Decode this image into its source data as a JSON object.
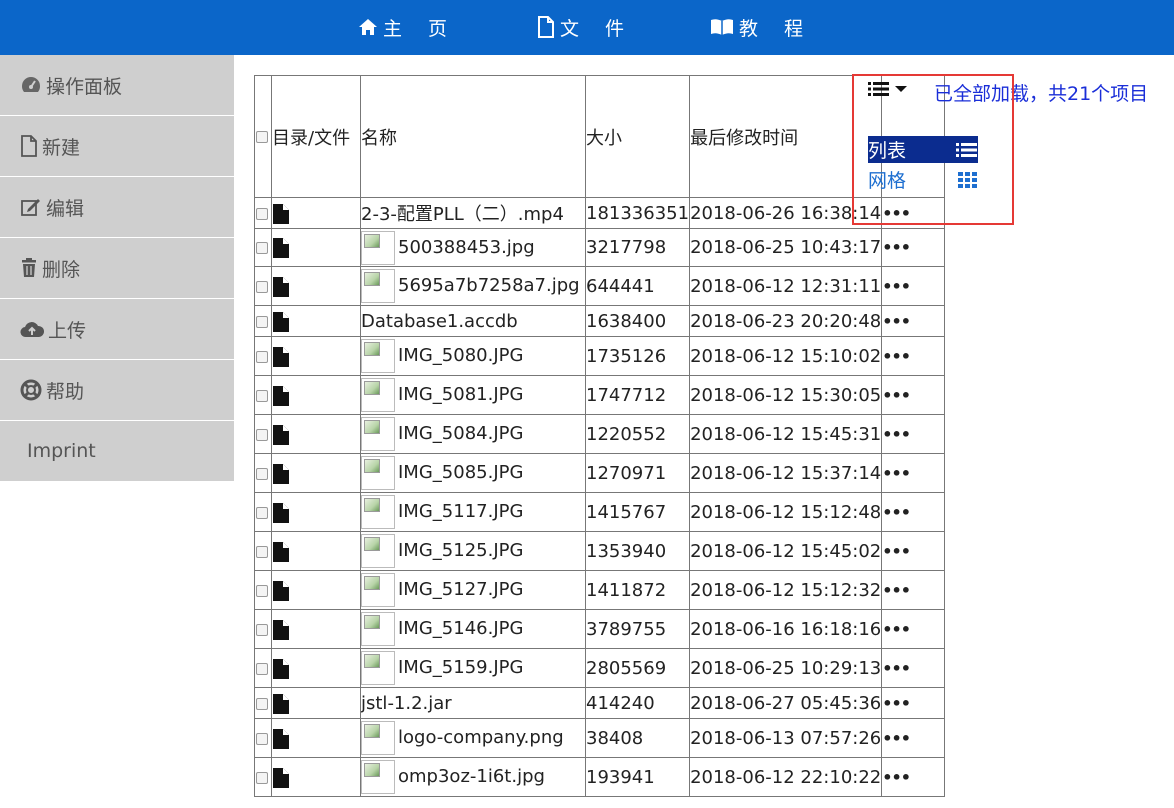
{
  "nav": {
    "home": "主 页",
    "files": "文 件",
    "tutorial": "教 程"
  },
  "sidebar": {
    "items": [
      {
        "label": "操作面板",
        "icon": "dashboard-icon"
      },
      {
        "label": "新建",
        "icon": "file-icon"
      },
      {
        "label": "编辑",
        "icon": "edit-icon"
      },
      {
        "label": "删除",
        "icon": "trash-icon"
      },
      {
        "label": "上传",
        "icon": "cloud-upload-icon"
      },
      {
        "label": "帮助",
        "icon": "lifebuoy-icon"
      },
      {
        "label": "Imprint",
        "icon": ""
      }
    ]
  },
  "table": {
    "headers": {
      "type": "目录/文件",
      "name": "名称",
      "size": "大小",
      "mtime": "最后修改时间"
    },
    "rows": [
      {
        "name": "2-3-配置PLL（二）.mp4",
        "size": "181336351",
        "mtime": "2018-06-26 16:38:14",
        "thumb": false
      },
      {
        "name": "500388453.jpg",
        "size": "3217798",
        "mtime": "2018-06-25 10:43:17",
        "thumb": true
      },
      {
        "name": "5695a7b7258a7.jpg",
        "size": "644441",
        "mtime": "2018-06-12 12:31:11",
        "thumb": true
      },
      {
        "name": "Database1.accdb",
        "size": "1638400",
        "mtime": "2018-06-23 20:20:48",
        "thumb": false
      },
      {
        "name": "IMG_5080.JPG",
        "size": "1735126",
        "mtime": "2018-06-12 15:10:02",
        "thumb": true
      },
      {
        "name": "IMG_5081.JPG",
        "size": "1747712",
        "mtime": "2018-06-12 15:30:05",
        "thumb": true
      },
      {
        "name": "IMG_5084.JPG",
        "size": "1220552",
        "mtime": "2018-06-12 15:45:31",
        "thumb": true
      },
      {
        "name": "IMG_5085.JPG",
        "size": "1270971",
        "mtime": "2018-06-12 15:37:14",
        "thumb": true
      },
      {
        "name": "IMG_5117.JPG",
        "size": "1415767",
        "mtime": "2018-06-12 15:12:48",
        "thumb": true
      },
      {
        "name": "IMG_5125.JPG",
        "size": "1353940",
        "mtime": "2018-06-12 15:45:02",
        "thumb": true
      },
      {
        "name": "IMG_5127.JPG",
        "size": "1411872",
        "mtime": "2018-06-12 15:12:32",
        "thumb": true
      },
      {
        "name": "IMG_5146.JPG",
        "size": "3789755",
        "mtime": "2018-06-16 16:18:16",
        "thumb": true
      },
      {
        "name": "IMG_5159.JPG",
        "size": "2805569",
        "mtime": "2018-06-25 10:29:13",
        "thumb": true
      },
      {
        "name": "jstl-1.2.jar",
        "size": "414240",
        "mtime": "2018-06-27 05:45:36",
        "thumb": false
      },
      {
        "name": "logo-company.png",
        "size": "38408",
        "mtime": "2018-06-13 07:57:26",
        "thumb": true
      },
      {
        "name": "omp3oz-1i6t.jpg",
        "size": "193941",
        "mtime": "2018-06-12 22:10:22",
        "thumb": true
      }
    ],
    "row_action": "•••"
  },
  "view_switcher": {
    "list_label": "列表",
    "grid_label": "网格"
  },
  "load_status": "已全部加载，共21个项目",
  "colors": {
    "nav_bg": "#0b66c9",
    "sidebar_bg": "#cfcfcf",
    "active_view_bg": "#0b2c8f",
    "status_text": "#1a2ed8",
    "highlight": "#e53935"
  }
}
